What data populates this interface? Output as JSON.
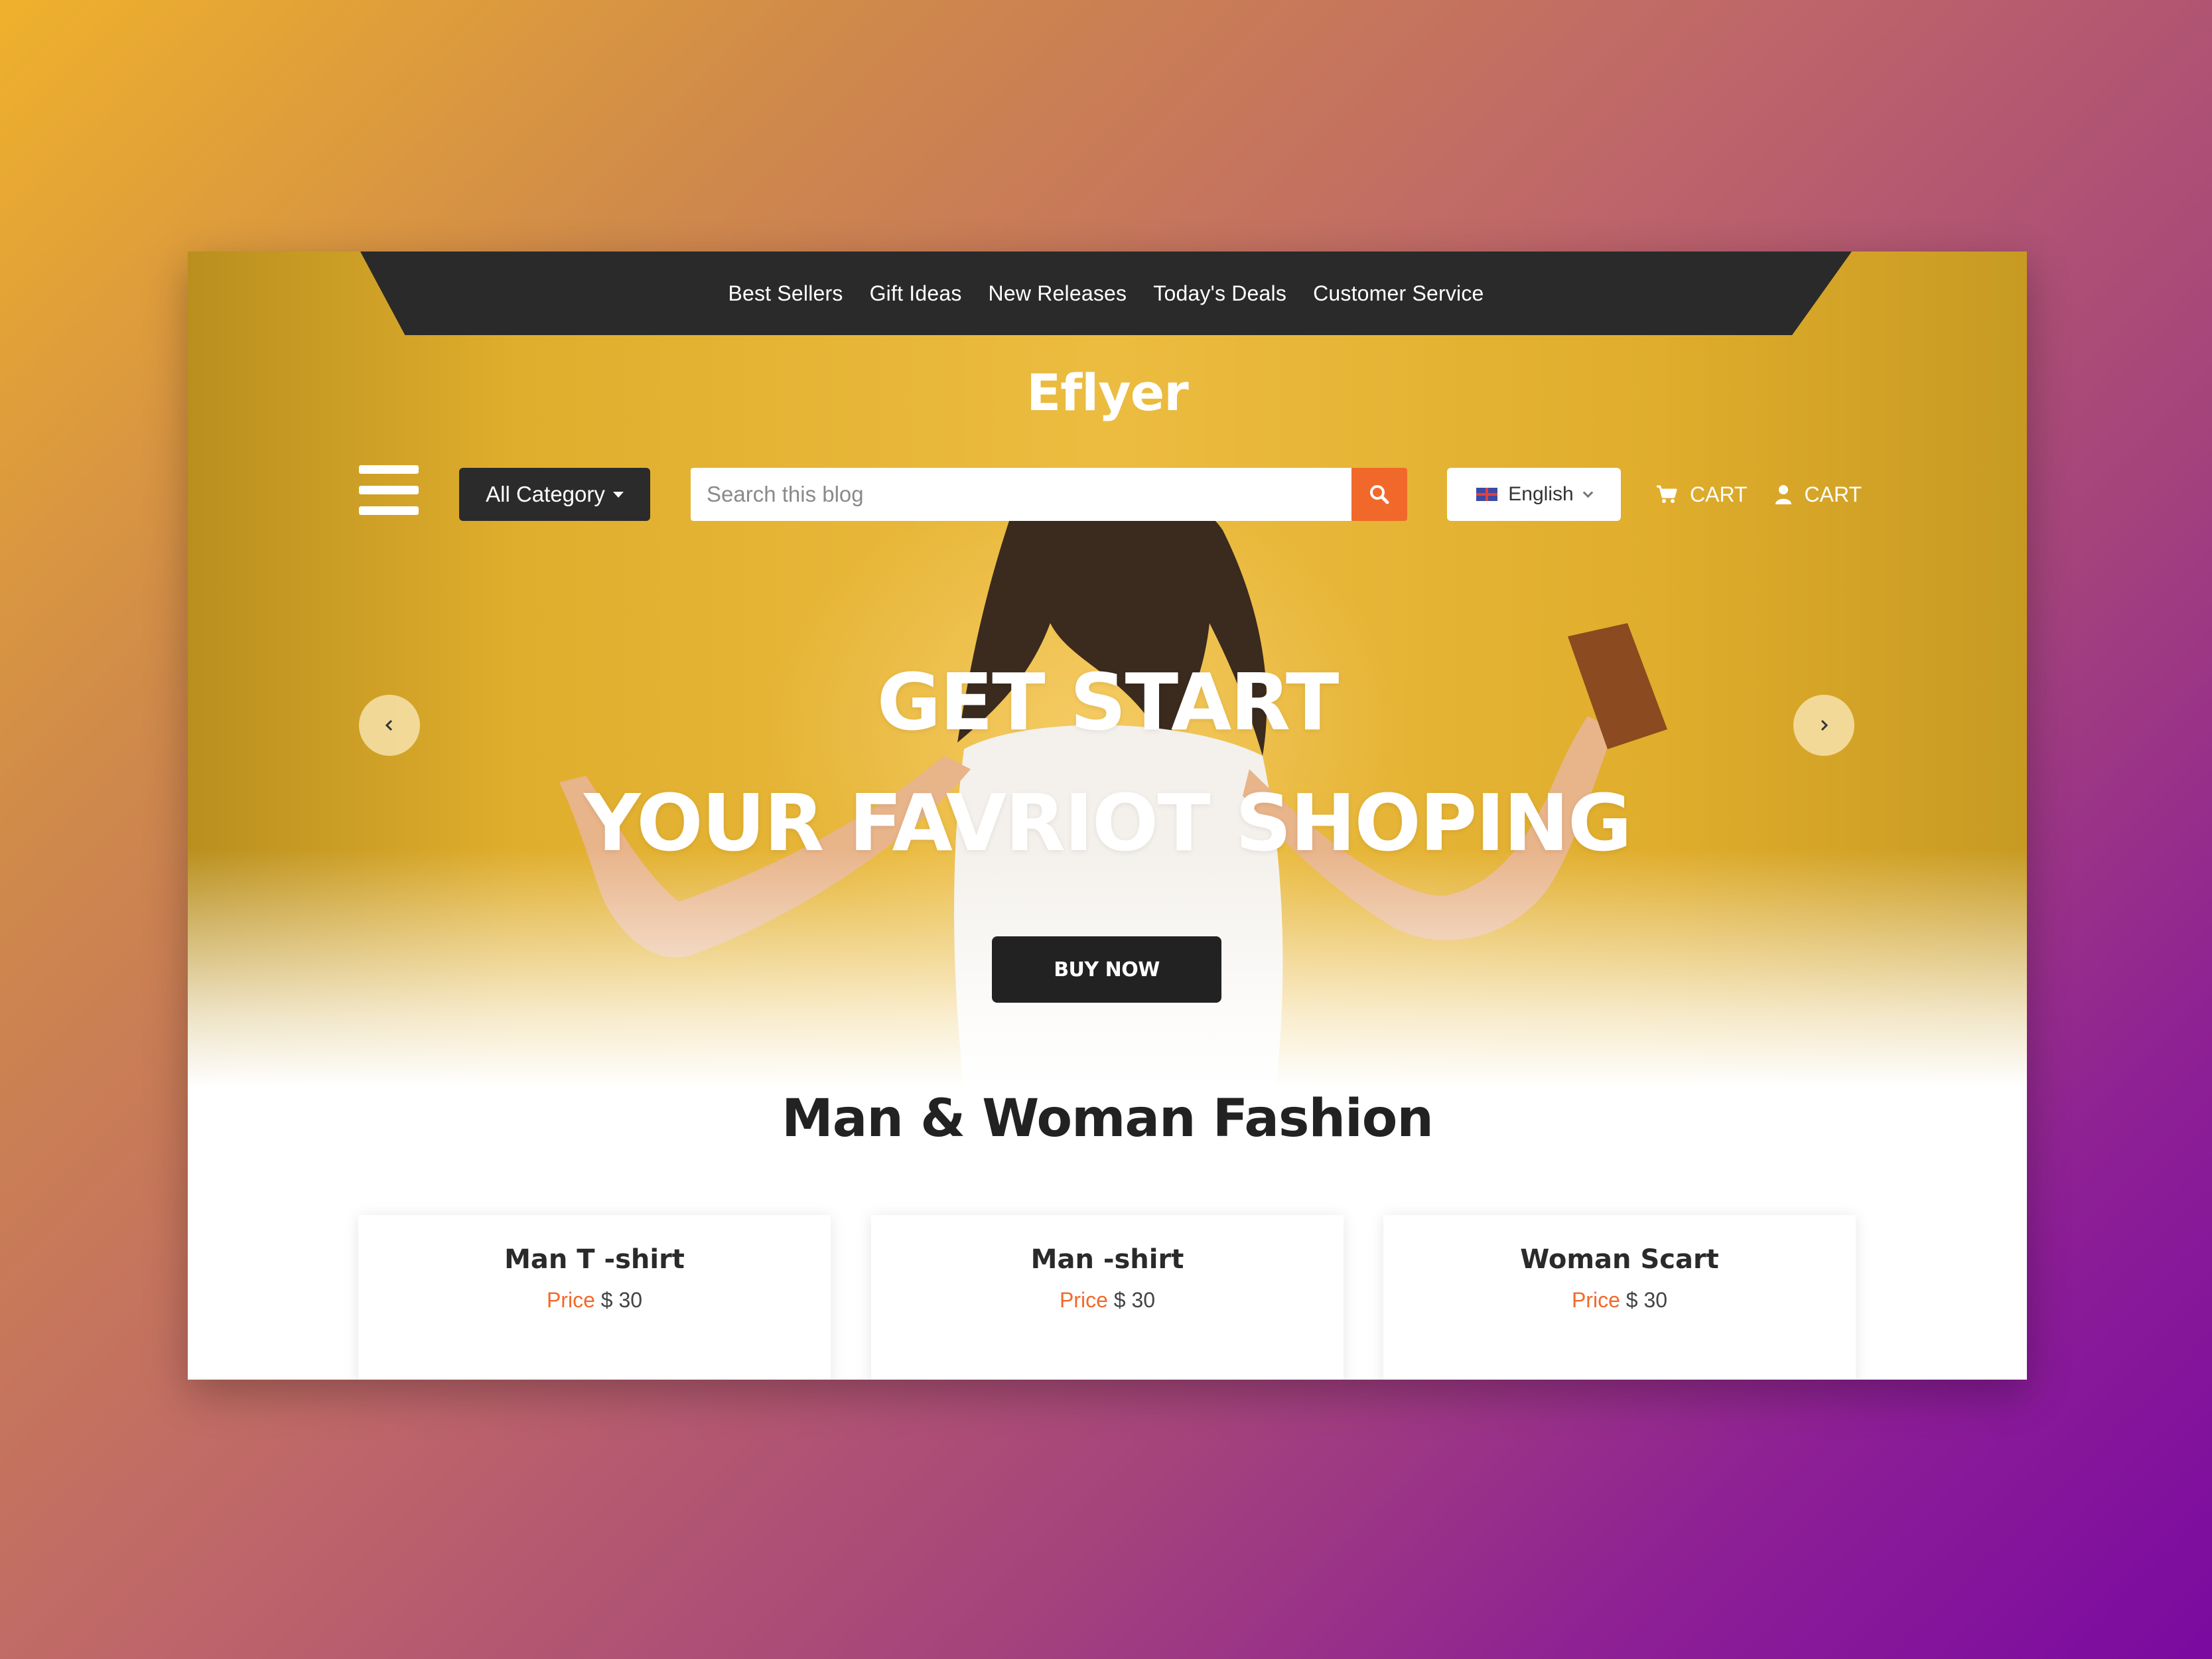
{
  "top_nav": {
    "links": [
      "Best Sellers",
      "Gift Ideas",
      "New Releases",
      "Today's Deals",
      "Customer Service"
    ]
  },
  "brand": {
    "logo_text": "Eflyer"
  },
  "toolbar": {
    "category_label": "All Category",
    "search_placeholder": "Search this blog",
    "language": "English",
    "cart_label_1": "CART",
    "cart_label_2": "CART"
  },
  "hero": {
    "title_line_1": "GET START",
    "title_line_2": "YOUR FAVRIOT SHOPING",
    "cta_label": "BUY NOW"
  },
  "section": {
    "title": "Man & Woman Fashion",
    "products": [
      {
        "name": "Man T -shirt",
        "price_label": "Price",
        "price": "$ 30"
      },
      {
        "name": "Man -shirt",
        "price_label": "Price",
        "price": "$ 30"
      },
      {
        "name": "Woman Scart",
        "price_label": "Price",
        "price": "$ 30"
      }
    ]
  },
  "colors": {
    "accent": "#f1692a",
    "dark": "#2a2a2a",
    "hero_yellow": "#e6b232"
  },
  "icons": [
    "menu-icon",
    "caret-down-icon",
    "search-icon",
    "flag-icon",
    "chevron-down-icon",
    "cart-icon",
    "user-icon",
    "chevron-left-icon",
    "chevron-right-icon"
  ]
}
